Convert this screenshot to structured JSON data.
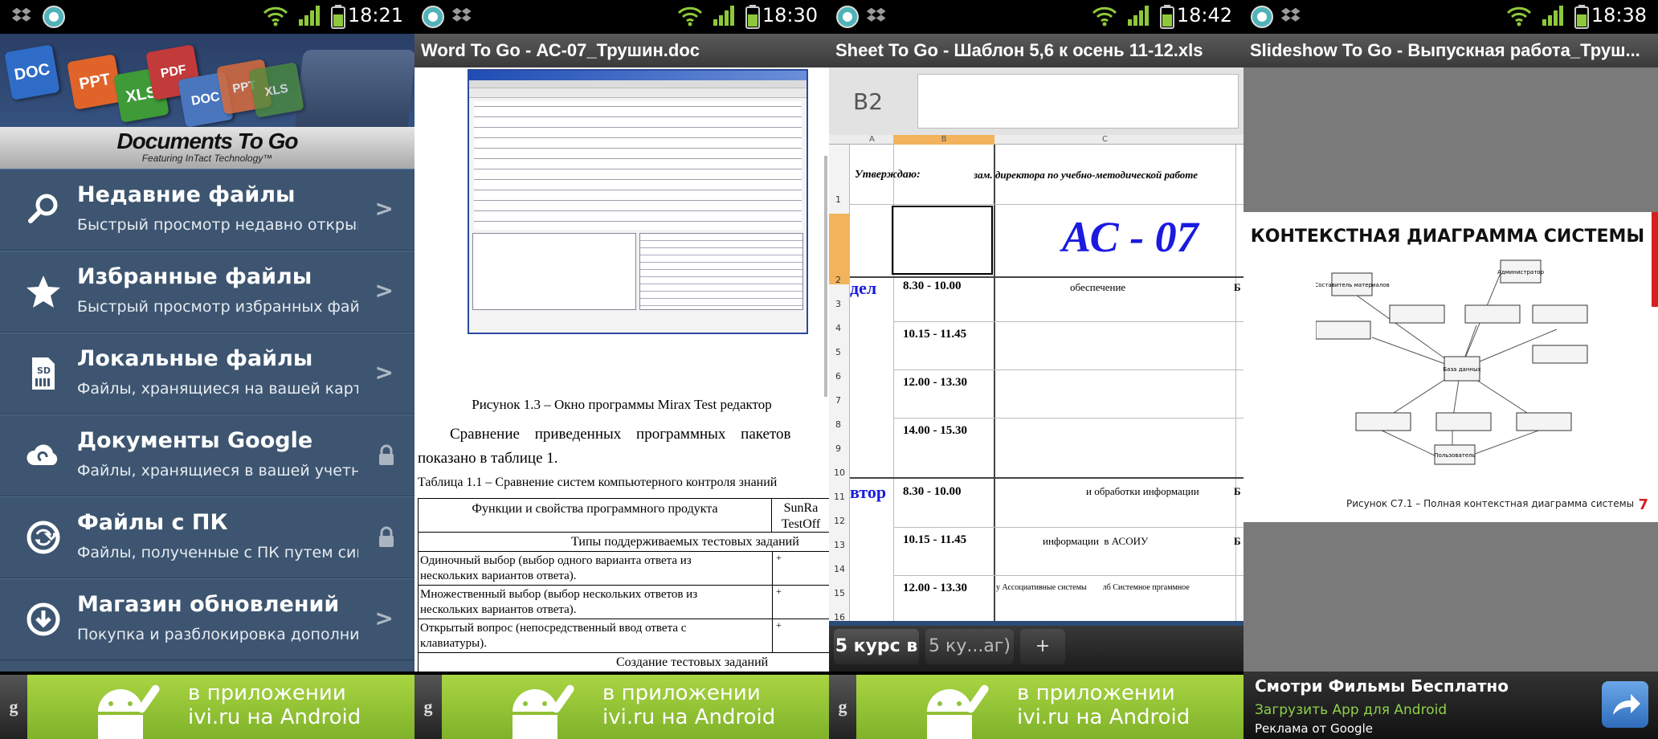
{
  "status": {
    "times": [
      "18:21",
      "18:30",
      "18:42",
      "18:38"
    ]
  },
  "panel1": {
    "tiles": [
      "DOC",
      "PPT",
      "XLS",
      "PDF",
      "DOC",
      "PPT",
      "XLS"
    ],
    "brand": "Documents To Go",
    "brand_sub": "Featuring InTact Technology™",
    "items": [
      {
        "title": "Недавние файлы",
        "sub": "Быстрый просмотр недавно открывав",
        "right": ">"
      },
      {
        "title": "Избранные файлы",
        "sub": "Быстрый просмотр избранных файлов",
        "right": ">"
      },
      {
        "title": "Локальные файлы",
        "sub": "Файлы, хранящиеся на вашей карте",
        "right": ">"
      },
      {
        "title": "Документы Google",
        "sub": "Файлы, хранящиеся в вашей учетной",
        "right": "lock"
      },
      {
        "title": "Файлы с ПК",
        "sub": "Файлы, полученные с ПК путем синхр",
        "right": "lock"
      },
      {
        "title": "Магазин обновлений",
        "sub": "Покупка и разблокировка дополнител",
        "right": ">"
      }
    ],
    "sd_label": "SD"
  },
  "ad_banner": {
    "g": "g",
    "line1": "в приложении",
    "line2": "ivi.ru на Android"
  },
  "panel2": {
    "title": "Word To Go - АС-07_Трушин.doc",
    "caption": "Рисунок 1.3 – Окно программы Mirax Test редактор",
    "para1": "Сравнение приведенных программных пакетов",
    "para2": "показано в таблице 1.",
    "table_caption": "Таблица 1.1 – Сравнение систем компьютерного контроля знаний",
    "table": {
      "col1": "Функции и свойства программного продукта",
      "col2a": "SunRa",
      "col2b": "TestOff",
      "section1": "Типы поддерживаемых тестовых заданий",
      "rows": [
        {
          "a": "Одиночный выбор (выбор одного варианта ответа из",
          "b": "нескольких вариантов ответа).",
          "v": "+"
        },
        {
          "a": "Множественный выбор (выбор нескольких ответов из",
          "b": "нескольких вариантов ответа).",
          "v": "+"
        },
        {
          "a": "Открытый вопрос (непосредственный ввод ответа с",
          "b": "клавиатуры).",
          "v": "+"
        }
      ],
      "section2": "Создание тестовых заданий"
    }
  },
  "panel3": {
    "title": "Sheet To Go - Шаблон 5,6 к осень 11-12.xls",
    "cell_ref": "B2",
    "cols": [
      "A",
      "B",
      "C"
    ],
    "r1_a": "Утверждаю:",
    "r1_c": "зам. директора по учебно-методической работе",
    "r2_c": "АС - 07",
    "day1": "дел",
    "day2": "втор",
    "times": [
      "8.30 - 10.00",
      "10.15 - 11.45",
      "12.00 - 13.30",
      "14.00 - 15.30",
      "8.30 - 10.00",
      "10.15 - 11.45",
      "12.00 - 13.30"
    ],
    "c_texts": [
      "обеспечение",
      "",
      "",
      "",
      "и обработки информации",
      "информации  в АСОИУ",
      "у Ассоциативные системы        лб Системное пргаммное"
    ],
    "row_nums": [
      "1",
      "2",
      "3",
      "4",
      "5",
      "6",
      "7",
      "8",
      "9",
      "10",
      "11",
      "12",
      "13",
      "14",
      "15",
      "16"
    ],
    "right_letter": "Б",
    "tabs": [
      "5 курс в",
      "5 ку...аг)",
      "+"
    ]
  },
  "panel4": {
    "title": "Slideshow To Go - Выпускная работа_Труш...",
    "slide_title": "КОНТЕКСТНАЯ ДИАГРАММА СИСТЕМЫ",
    "slide_caption": "Рисунок С7.1 – Полная контекстная диаграмма системы",
    "page_num": "7",
    "nodes": [
      "Составитель материалов",
      "Администратор",
      "База данных",
      "Пользователь"
    ],
    "ad_title": "Смотри Фильмы Бесплатно",
    "ad_sub": "Загрузить App для Android",
    "ad_foot": "Реклама от Google"
  }
}
